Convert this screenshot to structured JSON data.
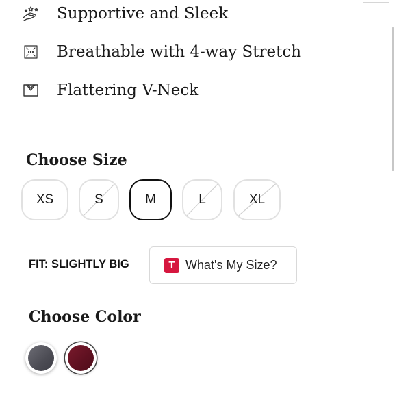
{
  "features": [
    {
      "label": "Supportive and Sleek",
      "icon": "support-icon"
    },
    {
      "label": "Breathable with 4-way Stretch",
      "icon": "stretch-icon"
    },
    {
      "label": "Flattering V-Neck",
      "icon": "v-neck-icon"
    }
  ],
  "size": {
    "title": "Choose Size",
    "options": [
      {
        "label": "XS",
        "available": true,
        "selected": false
      },
      {
        "label": "S",
        "available": false,
        "selected": false
      },
      {
        "label": "M",
        "available": true,
        "selected": true
      },
      {
        "label": "L",
        "available": false,
        "selected": false
      },
      {
        "label": "XL",
        "available": false,
        "selected": false
      }
    ]
  },
  "fit": {
    "label": "FIT: SLIGHTLY BIG",
    "whats_my_size": {
      "logo_text": "T",
      "label": "What's My Size?",
      "logo_color": "#d6173f"
    }
  },
  "color": {
    "title": "Choose Color",
    "swatches": [
      {
        "name": "gray",
        "hex": "#57575f",
        "selected": false
      },
      {
        "name": "burgundy",
        "hex": "#6a1525",
        "selected": true
      }
    ]
  }
}
